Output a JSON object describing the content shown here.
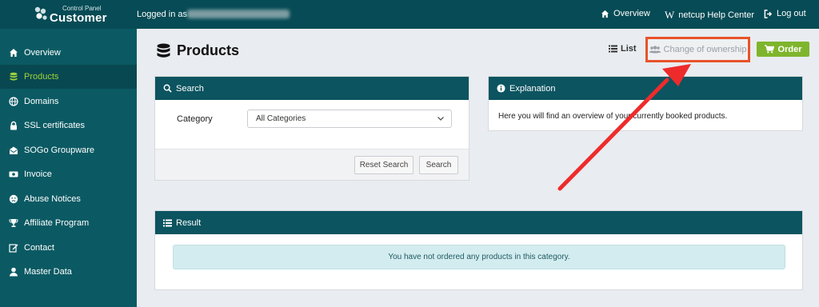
{
  "topbar": {
    "brand_small": "Control Panel",
    "brand_big": "Customer",
    "logged_in_label": "Logged in as",
    "nav": [
      {
        "label": "Overview",
        "icon": "home-icon"
      },
      {
        "label": "netcup Help Center",
        "icon": "wikipedia-icon"
      },
      {
        "label": "Log out",
        "icon": "logout-icon"
      }
    ]
  },
  "sidebar": {
    "items": [
      {
        "label": "Overview",
        "icon": "home-icon"
      },
      {
        "label": "Products",
        "icon": "database-icon",
        "active": true
      },
      {
        "label": "Domains",
        "icon": "globe-icon"
      },
      {
        "label": "SSL certificates",
        "icon": "lock-icon"
      },
      {
        "label": "SOGo Groupware",
        "icon": "envelope-open-icon"
      },
      {
        "label": "Invoice",
        "icon": "money-bill-icon"
      },
      {
        "label": "Abuse Notices",
        "icon": "frown-icon"
      },
      {
        "label": "Affiliate Program",
        "icon": "trophy-icon"
      },
      {
        "label": "Contact",
        "icon": "edit-icon"
      },
      {
        "label": "Master Data",
        "icon": "user-icon"
      }
    ]
  },
  "main": {
    "title": "Products",
    "list_label": "List",
    "change_ownership_label": "Change of ownership",
    "order_label": "Order"
  },
  "search": {
    "title": "Search",
    "category_label": "Category",
    "category_value": "All Categories",
    "reset_label": "Reset Search",
    "search_label": "Search"
  },
  "explanation": {
    "title": "Explanation",
    "text": "Here you will find an overview of your currently booked products."
  },
  "result": {
    "title": "Result",
    "message": "You have not ordered any products in this category."
  },
  "colors": {
    "topbar": "#064b55",
    "sidebar": "#0b5a63",
    "active_text": "#9fd33d",
    "order_button": "#7fb52d",
    "highlight": "#e8532a",
    "arrow": "#ee2b2b"
  }
}
